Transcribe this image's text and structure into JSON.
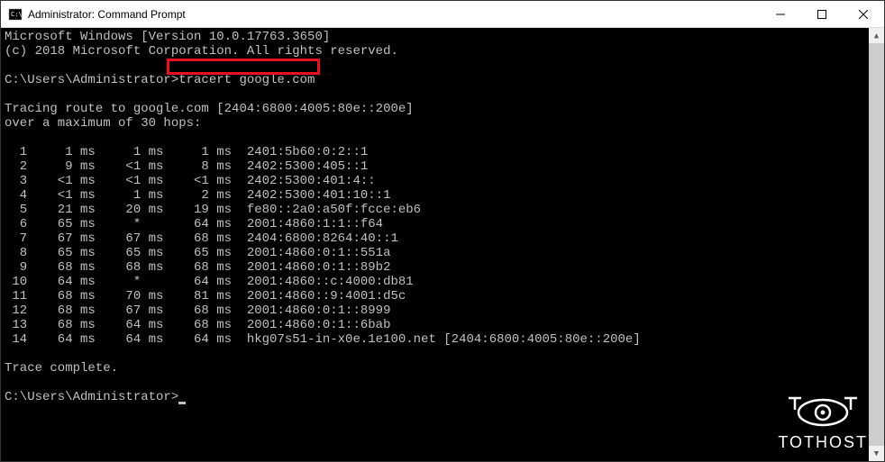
{
  "window": {
    "title": "Administrator: Command Prompt"
  },
  "header": {
    "line1": "Microsoft Windows [Version 10.0.17763.3650]",
    "line2": "(c) 2018 Microsoft Corporation. All rights reserved."
  },
  "prompt1": {
    "path": "C:\\Users\\Administrator>",
    "command": "tracert google.com"
  },
  "trace_header": {
    "line1": "Tracing route to google.com [2404:6800:4005:80e::200e]",
    "line2": "over a maximum of 30 hops:"
  },
  "hops": [
    {
      "n": "  1",
      "t1": "    1 ms",
      "t2": "    1 ms",
      "t3": "    1 ms",
      "host": "2401:5b60:0:2::1"
    },
    {
      "n": "  2",
      "t1": "    9 ms",
      "t2": "   <1 ms",
      "t3": "    8 ms",
      "host": "2402:5300:405::1"
    },
    {
      "n": "  3",
      "t1": "   <1 ms",
      "t2": "   <1 ms",
      "t3": "   <1 ms",
      "host": "2402:5300:401:4::"
    },
    {
      "n": "  4",
      "t1": "   <1 ms",
      "t2": "    1 ms",
      "t3": "    2 ms",
      "host": "2402:5300:401:10::1"
    },
    {
      "n": "  5",
      "t1": "   21 ms",
      "t2": "   20 ms",
      "t3": "   19 ms",
      "host": "fe80::2a0:a50f:fcce:eb6"
    },
    {
      "n": "  6",
      "t1": "   65 ms",
      "t2": "    *   ",
      "t3": "   64 ms",
      "host": "2001:4860:1:1::f64"
    },
    {
      "n": "  7",
      "t1": "   67 ms",
      "t2": "   67 ms",
      "t3": "   68 ms",
      "host": "2404:6800:8264:40::1"
    },
    {
      "n": "  8",
      "t1": "   65 ms",
      "t2": "   65 ms",
      "t3": "   65 ms",
      "host": "2001:4860:0:1::551a"
    },
    {
      "n": "  9",
      "t1": "   68 ms",
      "t2": "   68 ms",
      "t3": "   68 ms",
      "host": "2001:4860:0:1::89b2"
    },
    {
      "n": " 10",
      "t1": "   64 ms",
      "t2": "    *   ",
      "t3": "   64 ms",
      "host": "2001:4860::c:4000:db81"
    },
    {
      "n": " 11",
      "t1": "   68 ms",
      "t2": "   70 ms",
      "t3": "   81 ms",
      "host": "2001:4860::9:4001:d5c"
    },
    {
      "n": " 12",
      "t1": "   68 ms",
      "t2": "   67 ms",
      "t3": "   68 ms",
      "host": "2001:4860:0:1::8999"
    },
    {
      "n": " 13",
      "t1": "   68 ms",
      "t2": "   64 ms",
      "t3": "   68 ms",
      "host": "2001:4860:0:1::6bab"
    },
    {
      "n": " 14",
      "t1": "   64 ms",
      "t2": "   64 ms",
      "t3": "   64 ms",
      "host": "hkg07s51-in-x0e.1e100.net [2404:6800:4005:80e::200e]"
    }
  ],
  "trace_footer": "Trace complete.",
  "prompt2": {
    "path": "C:\\Users\\Administrator>"
  },
  "logo_text": "TOTHOST"
}
